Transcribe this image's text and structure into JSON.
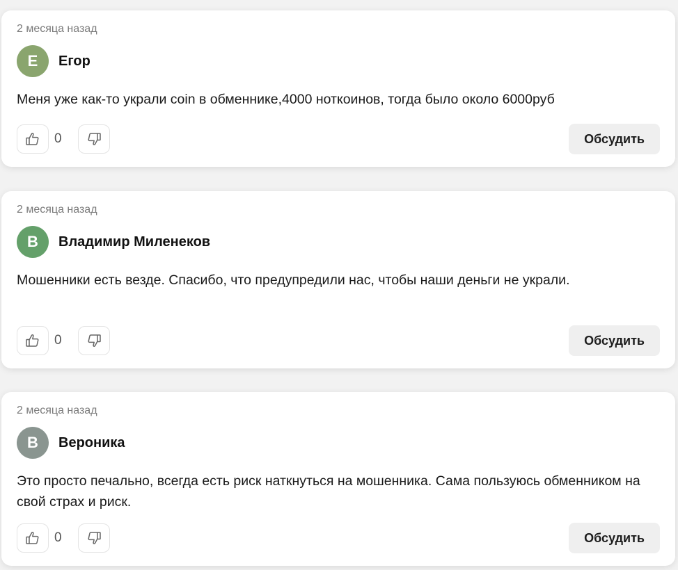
{
  "comments": [
    {
      "time": "2 месяца назад",
      "avatar_letter": "Е",
      "avatar_color": "#8aa56e",
      "author": "Егор",
      "text": "Меня уже как-то украли coin в обменнике,4000 ноткоинов, тогда было около 6000руб",
      "likes": "0",
      "discuss_label": "Обсудить"
    },
    {
      "time": "2 месяца назад",
      "avatar_letter": "В",
      "avatar_color": "#64a06a",
      "author": "Владимир Миленеков",
      "text": "Мошенники есть везде. Спасибо, что предупредили нас, чтобы наши деньги не украли.",
      "likes": "0",
      "discuss_label": "Обсудить"
    },
    {
      "time": "2 месяца назад",
      "avatar_letter": "В",
      "avatar_color": "#8a9590",
      "author": "Вероника",
      "text": "Это просто печально, всегда есть риск наткнуться на мошенника. Сама пользуюсь обменником на свой страх и риск.",
      "likes": "0",
      "discuss_label": "Обсудить"
    }
  ],
  "icons": {
    "like": "thumb-up-icon",
    "dislike": "thumb-down-icon"
  }
}
